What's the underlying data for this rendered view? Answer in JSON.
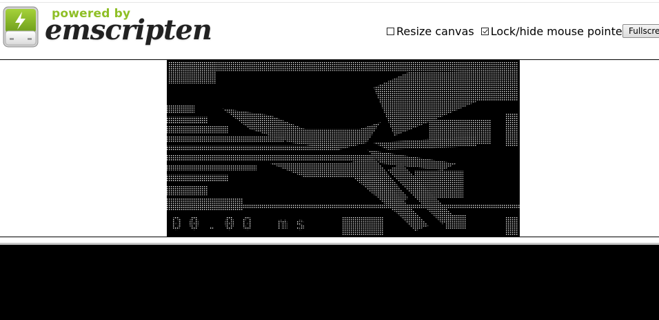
{
  "header": {
    "logo": {
      "powered_by": "powered by",
      "wordmark": "emscripten",
      "icon": "lightning-battery-icon",
      "accent_color": "#8fbf26"
    },
    "controls": {
      "resize_canvas": {
        "label": "Resize canvas",
        "checked": false
      },
      "lock_pointer": {
        "label": "Lock/hide mouse pointer",
        "checked": true
      },
      "fullscreen_label": "Fullscreen"
    }
  },
  "canvas": {
    "background": "#000000",
    "dot_color": "#ffffff",
    "bottom_text": "00.00 ms"
  },
  "console": {
    "background": "#000000",
    "text": ""
  }
}
